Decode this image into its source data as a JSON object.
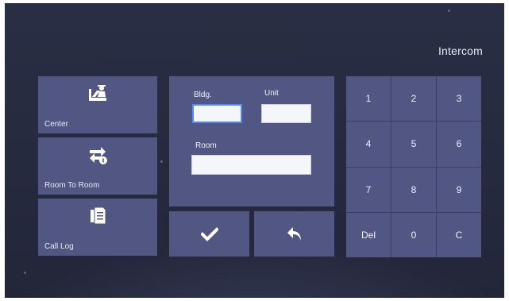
{
  "header": {
    "title": "Intercom"
  },
  "tiles": [
    {
      "label": "Center",
      "icon": "center-desk-icon"
    },
    {
      "label": "Room To Room",
      "icon": "room-transfer-icon"
    },
    {
      "label": "Call Log",
      "icon": "call-log-icon"
    }
  ],
  "entry": {
    "bldg_label": "Bldg.",
    "bldg_value": "",
    "unit_label": "Unit",
    "unit_value": "",
    "room_label": "Room",
    "room_value": ""
  },
  "actions": {
    "confirm_icon": "checkmark-icon",
    "back_icon": "back-arrow-icon"
  },
  "keypad": {
    "keys": [
      "1",
      "2",
      "3",
      "4",
      "5",
      "6",
      "7",
      "8",
      "9",
      "Del",
      "0",
      "C"
    ]
  },
  "colors": {
    "background": "#262a3f",
    "tile": "#525682",
    "focus": "#4f8bff"
  }
}
